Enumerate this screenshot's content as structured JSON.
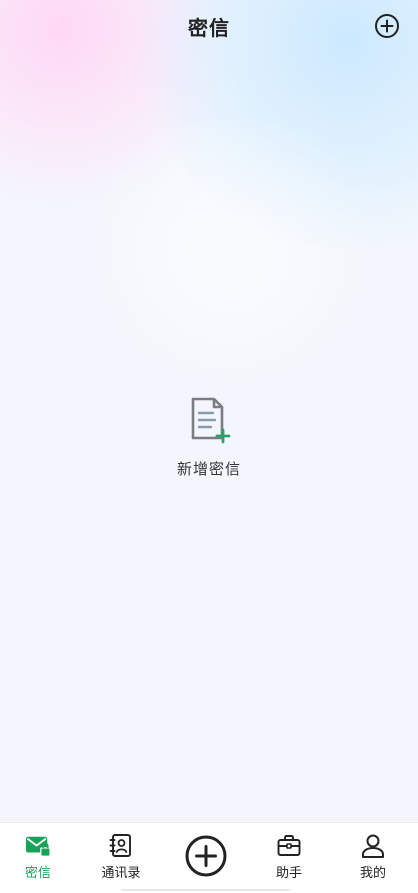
{
  "header": {
    "title": "密信",
    "add_icon": "plus-circle-icon"
  },
  "empty_state": {
    "icon": "new-document-icon",
    "label": "新增密信"
  },
  "tabbar": {
    "tabs": [
      {
        "label": "密信",
        "icon": "mail-lock-icon",
        "active": true
      },
      {
        "label": "通讯录",
        "icon": "contacts-icon",
        "active": false
      },
      {
        "label": "助手",
        "icon": "briefcase-icon",
        "active": false
      },
      {
        "label": "我的",
        "icon": "user-icon",
        "active": false
      }
    ],
    "center_icon": "plus-circle-icon"
  },
  "colors": {
    "accent": "#19a35a",
    "doc_green": "#2f9e68",
    "icon_dark": "#222222",
    "doc_gray": "#7a7d82"
  }
}
